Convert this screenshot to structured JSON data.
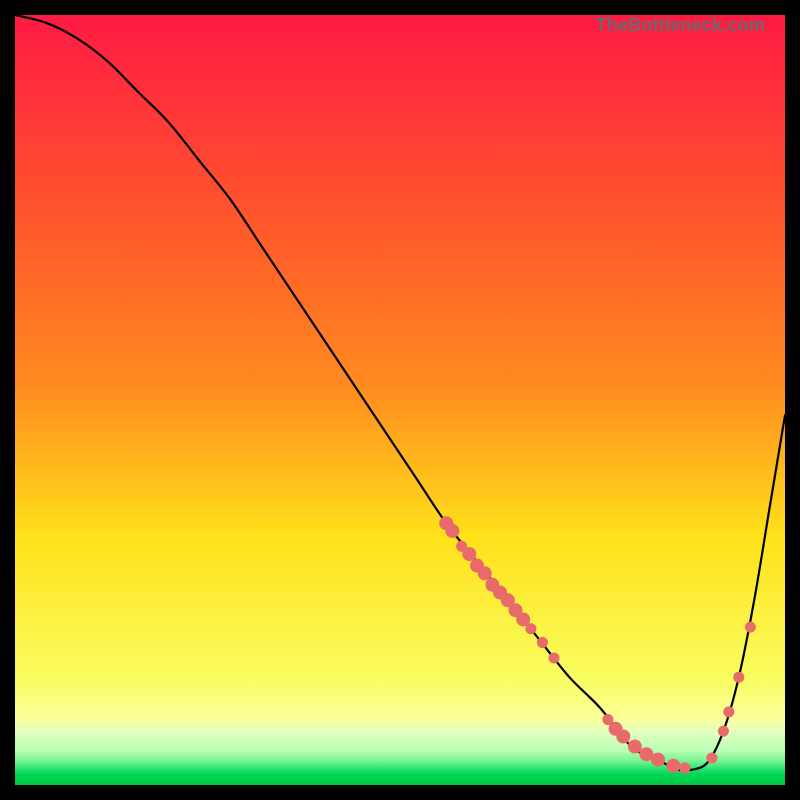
{
  "watermark": "TheBottleneck.com",
  "chart_data": {
    "type": "line",
    "title": "",
    "xlabel": "",
    "ylabel": "",
    "xlim": [
      0,
      100
    ],
    "ylim": [
      0,
      100
    ],
    "background_gradient": {
      "top": "#ff1a44",
      "mid1": "#ff8a1f",
      "mid2": "#ffe21a",
      "low": "#f9fd60",
      "bottom_band_pale": "#e3ffbe",
      "bottom_band_green": "#00d856"
    },
    "series": [
      {
        "name": "bottleneck-curve",
        "color": "#000000",
        "x": [
          0,
          4,
          8,
          12,
          16,
          20,
          24,
          28,
          32,
          36,
          40,
          44,
          48,
          52,
          56,
          60,
          64,
          68,
          72,
          76,
          80,
          82,
          84,
          86,
          88,
          90,
          92,
          94,
          96,
          98,
          100
        ],
        "y": [
          100,
          99,
          97,
          94,
          90,
          86,
          81,
          76,
          70,
          64,
          58,
          52,
          46,
          40,
          34,
          29,
          24,
          19,
          14,
          10,
          5,
          4,
          3,
          2,
          2,
          3,
          7,
          14,
          24,
          36,
          48
        ]
      }
    ],
    "markers": {
      "name": "highlight-points",
      "color": "#e96a6a",
      "radius_small": 5.5,
      "radius_large": 7,
      "points": [
        {
          "x": 56,
          "y": 34,
          "r": "large"
        },
        {
          "x": 56.8,
          "y": 33,
          "r": "large"
        },
        {
          "x": 58,
          "y": 31,
          "r": "small"
        },
        {
          "x": 59,
          "y": 30,
          "r": "large"
        },
        {
          "x": 60,
          "y": 28.5,
          "r": "large"
        },
        {
          "x": 61,
          "y": 27.5,
          "r": "large"
        },
        {
          "x": 62,
          "y": 26,
          "r": "large"
        },
        {
          "x": 63,
          "y": 25,
          "r": "large"
        },
        {
          "x": 64,
          "y": 24,
          "r": "large"
        },
        {
          "x": 65,
          "y": 22.7,
          "r": "large"
        },
        {
          "x": 66,
          "y": 21.5,
          "r": "large"
        },
        {
          "x": 67,
          "y": 20.3,
          "r": "small"
        },
        {
          "x": 68.5,
          "y": 18.5,
          "r": "small"
        },
        {
          "x": 70,
          "y": 16.5,
          "r": "small"
        },
        {
          "x": 77,
          "y": 8.5,
          "r": "small"
        },
        {
          "x": 78,
          "y": 7.3,
          "r": "large"
        },
        {
          "x": 79,
          "y": 6.3,
          "r": "large"
        },
        {
          "x": 80.5,
          "y": 5,
          "r": "large"
        },
        {
          "x": 82,
          "y": 4,
          "r": "large"
        },
        {
          "x": 83.5,
          "y": 3.3,
          "r": "large"
        },
        {
          "x": 85.5,
          "y": 2.5,
          "r": "large"
        },
        {
          "x": 87,
          "y": 2.2,
          "r": "small"
        },
        {
          "x": 90.5,
          "y": 3.5,
          "r": "small"
        },
        {
          "x": 92,
          "y": 7,
          "r": "small"
        },
        {
          "x": 92.7,
          "y": 9.5,
          "r": "small"
        },
        {
          "x": 94,
          "y": 14,
          "r": "small"
        },
        {
          "x": 95.5,
          "y": 20.5,
          "r": "small"
        }
      ]
    }
  }
}
